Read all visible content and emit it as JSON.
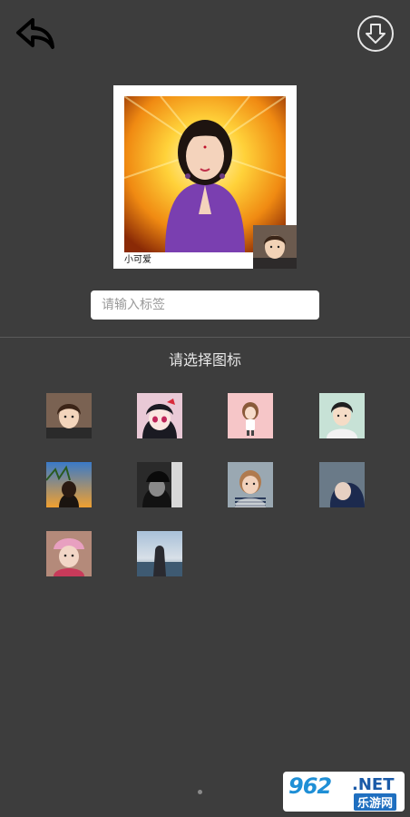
{
  "header": {
    "back_icon": "reply-arrow-icon",
    "download_icon": "circle-down-arrow-icon"
  },
  "preview": {
    "label": "小可爱"
  },
  "tag_input": {
    "placeholder": "请输入标签",
    "value": ""
  },
  "icon_section": {
    "title": "请选择图标",
    "icons": [
      {
        "name": "icon-cartoon-boy"
      },
      {
        "name": "icon-anime-girl"
      },
      {
        "name": "icon-cartoon-girl-pink"
      },
      {
        "name": "icon-cartoon-boy-green"
      },
      {
        "name": "icon-photo-sunset-girl"
      },
      {
        "name": "icon-photo-dark-hood"
      },
      {
        "name": "icon-photo-child-striped"
      },
      {
        "name": "icon-photo-blue-hood"
      },
      {
        "name": "icon-photo-girl-pink-hat"
      },
      {
        "name": "icon-photo-sea-silhouette"
      }
    ]
  },
  "watermark": {
    "brand": "962",
    "net": ".NET",
    "sub": "乐游网"
  },
  "colors": {
    "background": "#3d3d3d",
    "divider": "#5a5a5a",
    "title_text": "#e6e6e6"
  }
}
